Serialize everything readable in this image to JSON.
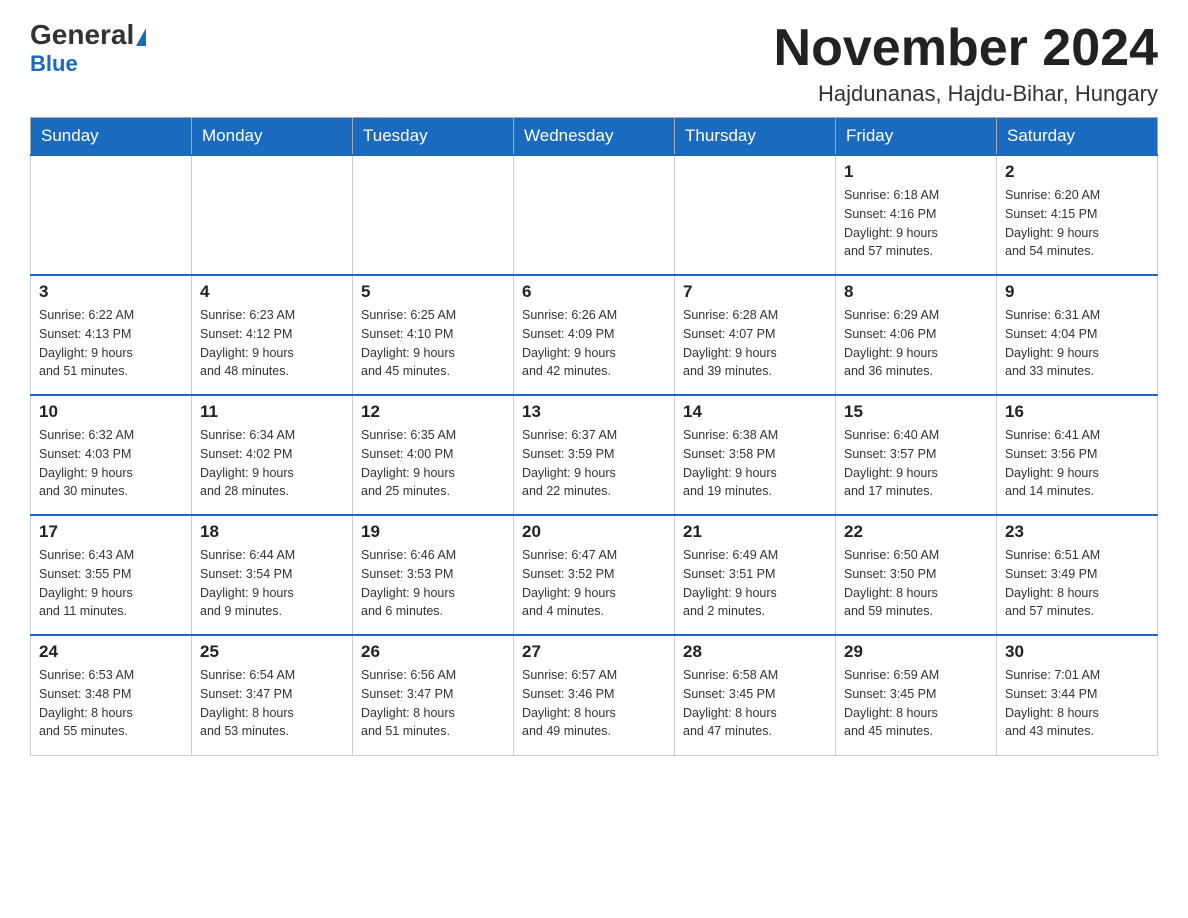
{
  "logo": {
    "text_general": "General",
    "text_blue": "Blue"
  },
  "title": "November 2024",
  "location": "Hajdunanas, Hajdu-Bihar, Hungary",
  "weekdays": [
    "Sunday",
    "Monday",
    "Tuesday",
    "Wednesday",
    "Thursday",
    "Friday",
    "Saturday"
  ],
  "weeks": [
    [
      {
        "day": "",
        "info": ""
      },
      {
        "day": "",
        "info": ""
      },
      {
        "day": "",
        "info": ""
      },
      {
        "day": "",
        "info": ""
      },
      {
        "day": "",
        "info": ""
      },
      {
        "day": "1",
        "info": "Sunrise: 6:18 AM\nSunset: 4:16 PM\nDaylight: 9 hours\nand 57 minutes."
      },
      {
        "day": "2",
        "info": "Sunrise: 6:20 AM\nSunset: 4:15 PM\nDaylight: 9 hours\nand 54 minutes."
      }
    ],
    [
      {
        "day": "3",
        "info": "Sunrise: 6:22 AM\nSunset: 4:13 PM\nDaylight: 9 hours\nand 51 minutes."
      },
      {
        "day": "4",
        "info": "Sunrise: 6:23 AM\nSunset: 4:12 PM\nDaylight: 9 hours\nand 48 minutes."
      },
      {
        "day": "5",
        "info": "Sunrise: 6:25 AM\nSunset: 4:10 PM\nDaylight: 9 hours\nand 45 minutes."
      },
      {
        "day": "6",
        "info": "Sunrise: 6:26 AM\nSunset: 4:09 PM\nDaylight: 9 hours\nand 42 minutes."
      },
      {
        "day": "7",
        "info": "Sunrise: 6:28 AM\nSunset: 4:07 PM\nDaylight: 9 hours\nand 39 minutes."
      },
      {
        "day": "8",
        "info": "Sunrise: 6:29 AM\nSunset: 4:06 PM\nDaylight: 9 hours\nand 36 minutes."
      },
      {
        "day": "9",
        "info": "Sunrise: 6:31 AM\nSunset: 4:04 PM\nDaylight: 9 hours\nand 33 minutes."
      }
    ],
    [
      {
        "day": "10",
        "info": "Sunrise: 6:32 AM\nSunset: 4:03 PM\nDaylight: 9 hours\nand 30 minutes."
      },
      {
        "day": "11",
        "info": "Sunrise: 6:34 AM\nSunset: 4:02 PM\nDaylight: 9 hours\nand 28 minutes."
      },
      {
        "day": "12",
        "info": "Sunrise: 6:35 AM\nSunset: 4:00 PM\nDaylight: 9 hours\nand 25 minutes."
      },
      {
        "day": "13",
        "info": "Sunrise: 6:37 AM\nSunset: 3:59 PM\nDaylight: 9 hours\nand 22 minutes."
      },
      {
        "day": "14",
        "info": "Sunrise: 6:38 AM\nSunset: 3:58 PM\nDaylight: 9 hours\nand 19 minutes."
      },
      {
        "day": "15",
        "info": "Sunrise: 6:40 AM\nSunset: 3:57 PM\nDaylight: 9 hours\nand 17 minutes."
      },
      {
        "day": "16",
        "info": "Sunrise: 6:41 AM\nSunset: 3:56 PM\nDaylight: 9 hours\nand 14 minutes."
      }
    ],
    [
      {
        "day": "17",
        "info": "Sunrise: 6:43 AM\nSunset: 3:55 PM\nDaylight: 9 hours\nand 11 minutes."
      },
      {
        "day": "18",
        "info": "Sunrise: 6:44 AM\nSunset: 3:54 PM\nDaylight: 9 hours\nand 9 minutes."
      },
      {
        "day": "19",
        "info": "Sunrise: 6:46 AM\nSunset: 3:53 PM\nDaylight: 9 hours\nand 6 minutes."
      },
      {
        "day": "20",
        "info": "Sunrise: 6:47 AM\nSunset: 3:52 PM\nDaylight: 9 hours\nand 4 minutes."
      },
      {
        "day": "21",
        "info": "Sunrise: 6:49 AM\nSunset: 3:51 PM\nDaylight: 9 hours\nand 2 minutes."
      },
      {
        "day": "22",
        "info": "Sunrise: 6:50 AM\nSunset: 3:50 PM\nDaylight: 8 hours\nand 59 minutes."
      },
      {
        "day": "23",
        "info": "Sunrise: 6:51 AM\nSunset: 3:49 PM\nDaylight: 8 hours\nand 57 minutes."
      }
    ],
    [
      {
        "day": "24",
        "info": "Sunrise: 6:53 AM\nSunset: 3:48 PM\nDaylight: 8 hours\nand 55 minutes."
      },
      {
        "day": "25",
        "info": "Sunrise: 6:54 AM\nSunset: 3:47 PM\nDaylight: 8 hours\nand 53 minutes."
      },
      {
        "day": "26",
        "info": "Sunrise: 6:56 AM\nSunset: 3:47 PM\nDaylight: 8 hours\nand 51 minutes."
      },
      {
        "day": "27",
        "info": "Sunrise: 6:57 AM\nSunset: 3:46 PM\nDaylight: 8 hours\nand 49 minutes."
      },
      {
        "day": "28",
        "info": "Sunrise: 6:58 AM\nSunset: 3:45 PM\nDaylight: 8 hours\nand 47 minutes."
      },
      {
        "day": "29",
        "info": "Sunrise: 6:59 AM\nSunset: 3:45 PM\nDaylight: 8 hours\nand 45 minutes."
      },
      {
        "day": "30",
        "info": "Sunrise: 7:01 AM\nSunset: 3:44 PM\nDaylight: 8 hours\nand 43 minutes."
      }
    ]
  ]
}
